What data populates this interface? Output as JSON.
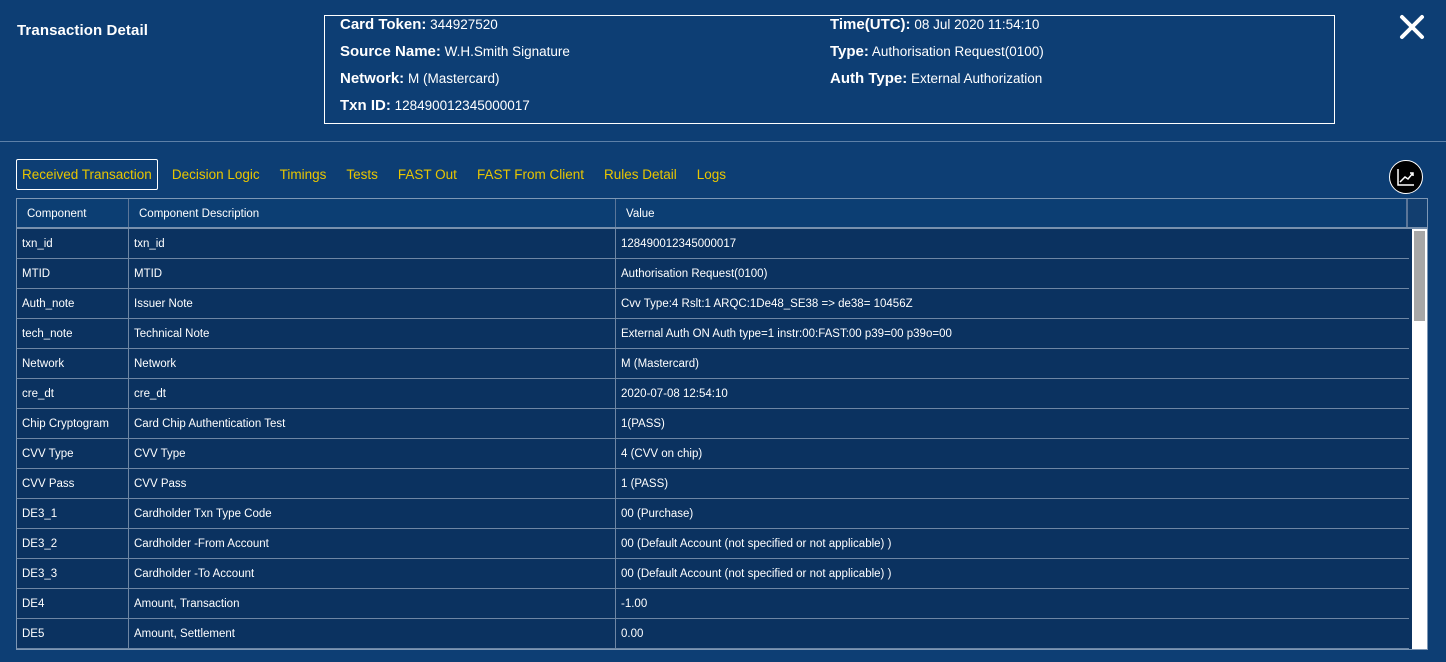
{
  "window": {
    "title": "Transaction Detail"
  },
  "summary": {
    "card_token_label": "Card Token:",
    "card_token": "344927520",
    "source_name_label": "Source Name:",
    "source_name": "W.H.Smith Signature",
    "network_label": "Network:",
    "network": "M (Mastercard)",
    "txn_id_label": "Txn ID:",
    "txn_id": "128490012345000017",
    "time_label": "Time(UTC):",
    "time": "08 Jul 2020 11:54:10",
    "type_label": "Type:",
    "type": "Authorisation Request(0100)",
    "auth_type_label": "Auth Type:",
    "auth_type": "External Authorization"
  },
  "tabs": [
    {
      "label": "Received Transaction",
      "active": true
    },
    {
      "label": "Decision Logic"
    },
    {
      "label": "Timings"
    },
    {
      "label": "Tests"
    },
    {
      "label": "FAST Out"
    },
    {
      "label": "FAST From Client"
    },
    {
      "label": "Rules Detail"
    },
    {
      "label": "Logs"
    }
  ],
  "grid": {
    "columns": [
      "Component",
      "Component Description",
      "Value"
    ],
    "rows": [
      [
        "txn_id",
        "txn_id",
        "128490012345000017"
      ],
      [
        "MTID",
        "MTID",
        "Authorisation Request(0100)"
      ],
      [
        "Auth_note",
        "Issuer Note",
        "Cvv Type:4 Rslt:1 ARQC:1De48_SE38 => de38= 10456Z"
      ],
      [
        "tech_note",
        "Technical Note",
        "External Auth ON Auth type=1 instr:00:FAST:00 p39=00 p39o=00"
      ],
      [
        "Network",
        "Network",
        "M (Mastercard)"
      ],
      [
        "cre_dt",
        "cre_dt",
        "2020-07-08 12:54:10"
      ],
      [
        "Chip Cryptogram",
        "Card Chip Authentication Test",
        "1(PASS)"
      ],
      [
        "CVV Type",
        "CVV Type",
        "4 (CVV on chip)"
      ],
      [
        "CVV Pass",
        "CVV Pass",
        "1 (PASS)"
      ],
      [
        "DE3_1",
        "Cardholder Txn Type Code",
        "00 (Purchase)"
      ],
      [
        "DE3_2",
        "Cardholder -From Account",
        "00 (Default Account (not specified or not applicable) )"
      ],
      [
        "DE3_3",
        "Cardholder -To Account",
        "00 (Default Account (not specified or not applicable) )"
      ],
      [
        "DE4",
        "Amount, Transaction",
        "-1.00"
      ],
      [
        "DE5",
        "Amount, Settlement",
        "0.00"
      ]
    ]
  },
  "icons": {
    "close": "close-icon",
    "chart": "line-chart-icon"
  },
  "colors": {
    "background": "#0d3e74",
    "tab_text": "#e9c600",
    "row_background": "#0b3260"
  }
}
